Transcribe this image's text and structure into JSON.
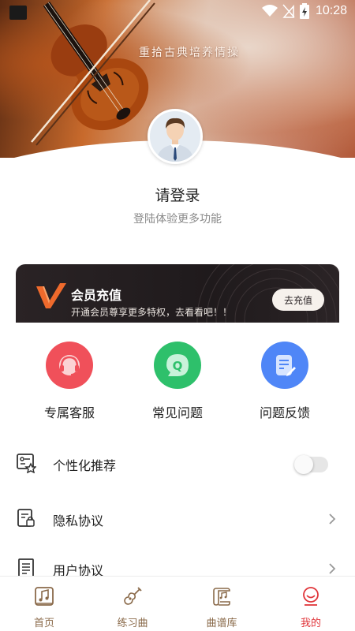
{
  "status_bar": {
    "time": "10:28"
  },
  "hero": {
    "motto": "重拾古典培养情操"
  },
  "profile": {
    "title": "请登录",
    "subtitle": "登陆体验更多功能"
  },
  "vip": {
    "logo_letter": "V",
    "title": "会员充值",
    "description": "开通会员尊享更多特权，去看看吧！！",
    "button": "去充值"
  },
  "quick_actions": [
    {
      "label": "专属客服",
      "icon": "headset-icon",
      "color": "#f0505a"
    },
    {
      "label": "常见问题",
      "icon": "faq-icon",
      "color": "#2ec06b"
    },
    {
      "label": "问题反馈",
      "icon": "feedback-icon",
      "color": "#4f86f7"
    }
  ],
  "settings": {
    "personalized": {
      "label": "个性化推荐",
      "enabled": false
    },
    "privacy": {
      "label": "隐私协议"
    },
    "user_agreement": {
      "label": "用户协议"
    }
  },
  "bottom_nav": [
    {
      "label": "首页",
      "icon": "music-note-icon",
      "active": false
    },
    {
      "label": "练习曲",
      "icon": "guitar-icon",
      "active": false
    },
    {
      "label": "曲谱库",
      "icon": "sheet-scroll-icon",
      "active": false
    },
    {
      "label": "我的",
      "icon": "profile-icon",
      "active": true
    }
  ],
  "colors": {
    "accent": "#e0353a",
    "nav_inactive": "#8a6a4a",
    "vip_bg": "#231d1f"
  }
}
